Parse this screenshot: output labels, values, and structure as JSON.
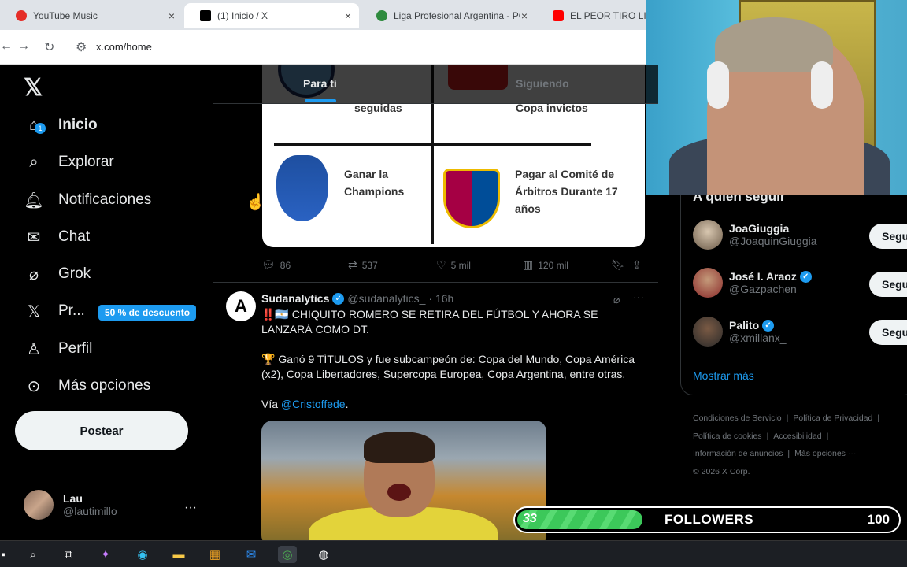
{
  "browser": {
    "tabs": [
      {
        "label": "YouTube Music",
        "close": "×"
      },
      {
        "label": "(1) Inicio / X",
        "close": "×"
      },
      {
        "label": "Liga Profesional Argentina - PO",
        "close": "×"
      },
      {
        "label": "EL PEOR TIRO LIBRE D"
      }
    ],
    "url": "x.com/home"
  },
  "nav": {
    "items": [
      {
        "label": "Inicio"
      },
      {
        "label": "Explorar"
      },
      {
        "label": "Notificaciones",
        "badge": "1"
      },
      {
        "label": "Chat"
      },
      {
        "label": "Grok"
      },
      {
        "label": "Pr...",
        "promo": "50 % de descuento"
      },
      {
        "label": "Perfil"
      },
      {
        "label": "Más opciones"
      }
    ],
    "post_button": "Postear",
    "user": {
      "name": "Lau",
      "handle": "@lautimillo_",
      "more": "···"
    }
  },
  "feed": {
    "tabs": {
      "for_you": "Para ti",
      "following": "Siguiendo"
    },
    "meme": {
      "top_left": "seguidas",
      "top_right": "Copa invictos",
      "bottom_left": "Ganar la Champions",
      "bottom_right": "Pagar al Comité de Árbitros Durante 17 años"
    },
    "actions": {
      "replies": "86",
      "reposts": "537",
      "likes": "5 mil",
      "views": "120 mil"
    },
    "tweet": {
      "avatar_letter": "A",
      "name": "Sudanalytics",
      "handle": "@sudanalytics_",
      "time": "· 16h",
      "line1": "‼️🇦🇷 CHIQUITO ROMERO SE RETIRA DEL FÚTBOL Y AHORA SE LANZARÁ COMO DT.",
      "line2": "🏆 Ganó 9 TÍTULOS y fue subcampeón de: Copa del Mundo, Copa América (x2), Copa Libertadores, Supercopa Europea, Copa Argentina, entre otras.",
      "via_prefix": "Vía ",
      "via_link": "@Cristoffede",
      "via_suffix": "."
    }
  },
  "right": {
    "suggest_title": "A quién seguir",
    "suggestions": [
      {
        "name": "JoaGiuggia",
        "handle": "@JoaquinGiuggia",
        "verified": false,
        "button": "Segu"
      },
      {
        "name": "José I. Araoz",
        "handle": "@Gazpachen",
        "verified": true,
        "button": "Segu"
      },
      {
        "name": "Palito",
        "handle": "@xmillanx_",
        "verified": true,
        "button": "Segu"
      }
    ],
    "show_more": "Mostrar más",
    "footer": [
      "Condiciones de Servicio",
      "|",
      "Política de Privacidad",
      "|",
      "Política de cookies",
      "|",
      "Accesibilidad",
      "|",
      "Información de anuncios",
      "|",
      "Más opciones ···",
      "© 2026 X Corp."
    ]
  },
  "overlay": {
    "followers_current": "33",
    "followers_label": "FOLLOWERS",
    "followers_goal": "100",
    "progress": 0.33
  },
  "colors": {
    "accent": "#1d9bf0",
    "bg": "#000000",
    "progress": "#3cc85a"
  }
}
